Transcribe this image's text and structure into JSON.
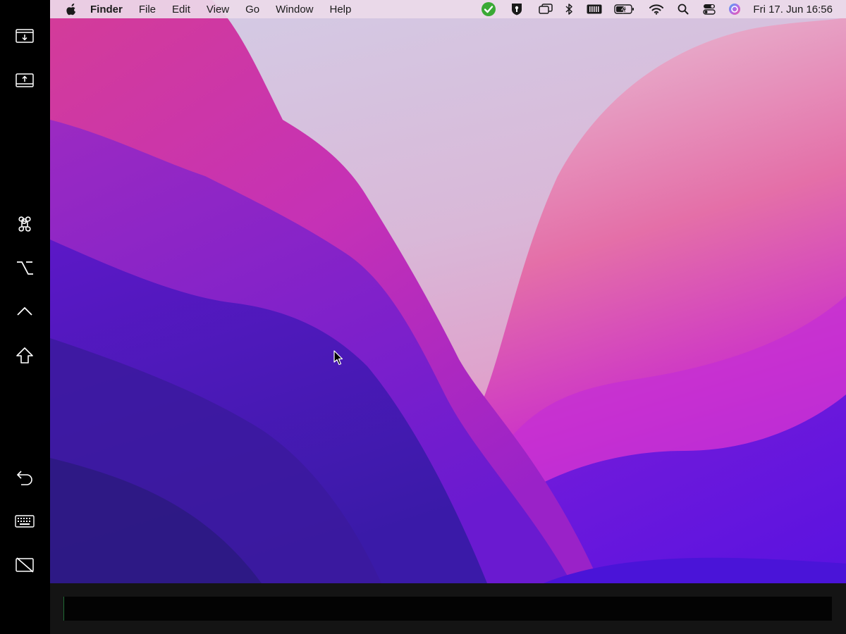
{
  "menubar": {
    "app_name": "Finder",
    "menus": [
      "File",
      "Edit",
      "View",
      "Go",
      "Window",
      "Help"
    ],
    "clock": "Fri 17. Jun  16:56"
  },
  "sidebar": {
    "buttons": [
      "download-screen",
      "upload-screen",
      "command-key",
      "option-key",
      "control-key",
      "shift-key",
      "undo",
      "keyboard",
      "disconnect-display"
    ]
  },
  "status_icons": [
    "check-circle-icon",
    "password-manager-icon",
    "screen-mirroring-icon",
    "bluetooth-icon",
    "memory-icon",
    "battery-charging-icon",
    "wifi-icon",
    "spotlight-search-icon",
    "control-center-icon",
    "siri-icon"
  ],
  "colors": {
    "menubar_bg": "#ecdae9",
    "check_green": "#3aa935",
    "wallpaper_top": "#d9c7e0",
    "wallpaper_pink": "#d63aa6",
    "wallpaper_purple": "#5a1bd0",
    "wallpaper_deep": "#2c1a8a"
  },
  "input": {
    "value": ""
  }
}
